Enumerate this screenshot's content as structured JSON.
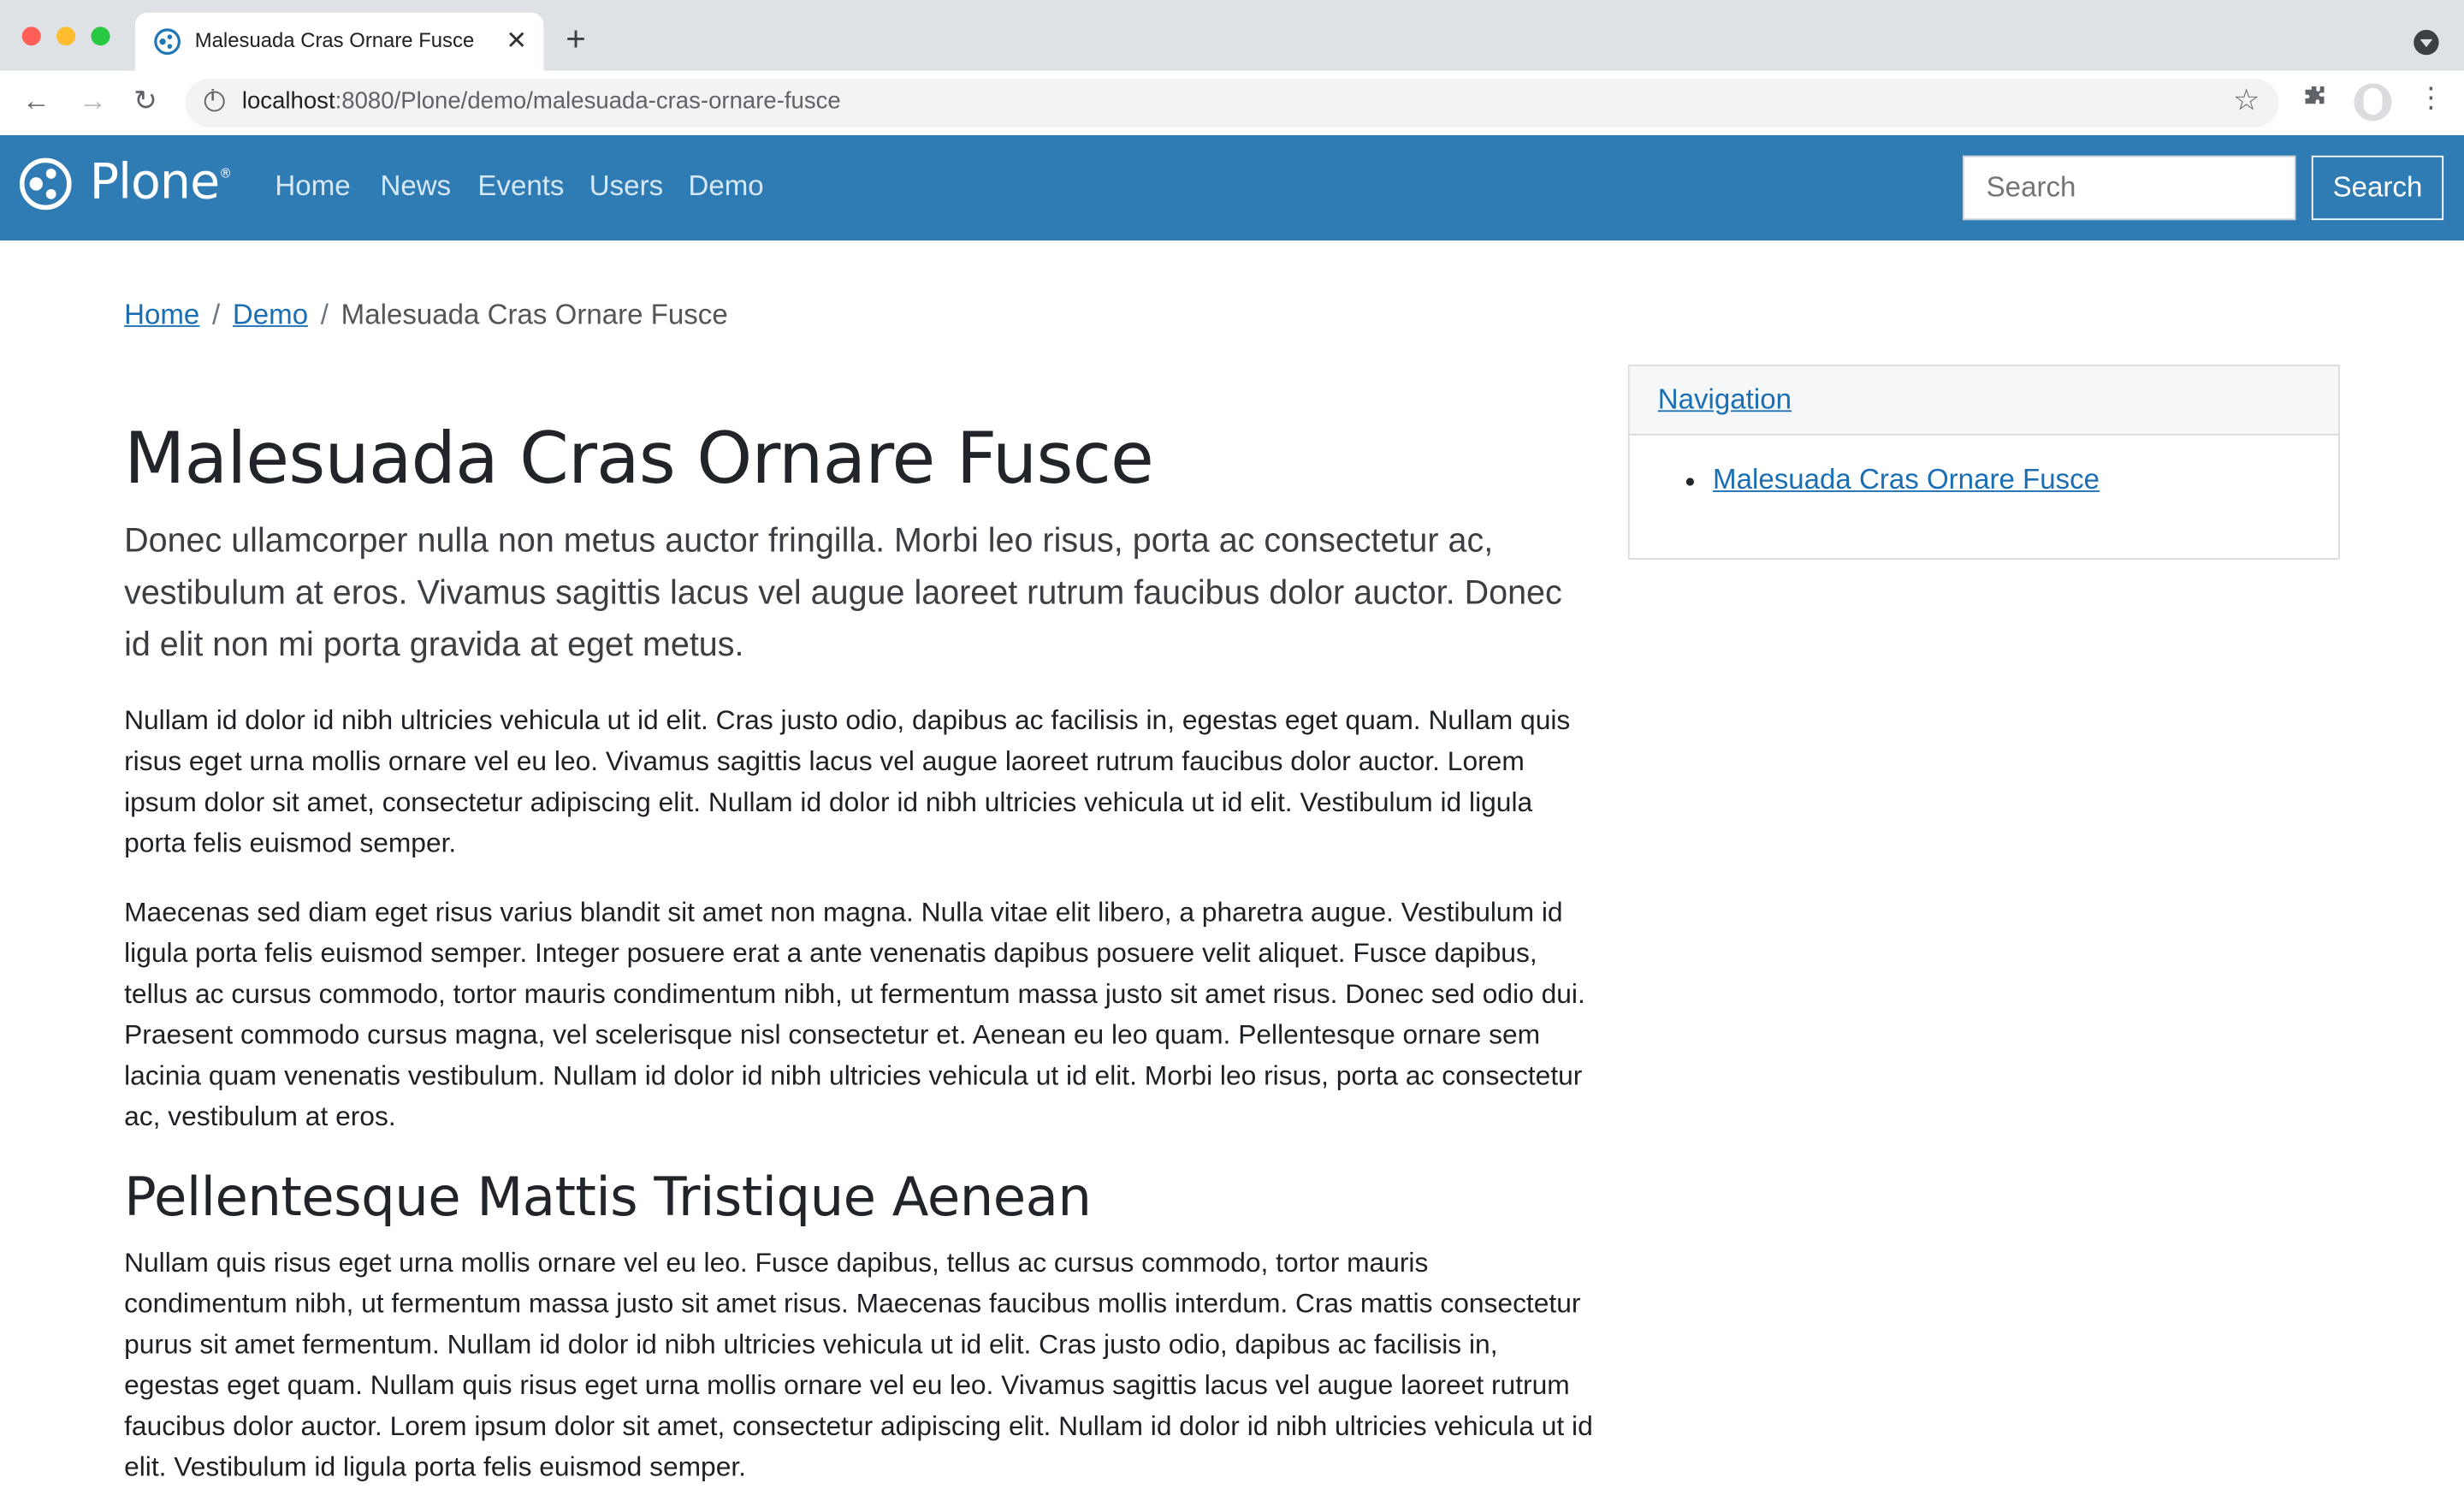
{
  "browser": {
    "tab_title": "Malesuada Cras Ornare Fusce",
    "url_host": "localhost",
    "url_rest": ":8080/Plone/demo/malesuada-cras-ornare-fusce"
  },
  "header": {
    "logo_text": "Plone",
    "nav": [
      "Home",
      "News",
      "Events",
      "Users",
      "Demo"
    ],
    "search_placeholder": "Search",
    "search_button": "Search",
    "brand_color": "#2f7cb4"
  },
  "breadcrumb": {
    "home": "Home",
    "demo": "Demo",
    "current": "Malesuada Cras Ornare Fusce"
  },
  "content": {
    "title": "Malesuada Cras Ornare Fusce",
    "lead": "Donec ullamcorper nulla non metus auctor fringilla. Morbi leo risus, porta ac consectetur ac, vestibulum at eros. Vivamus sagittis lacus vel augue laoreet rutrum faucibus dolor auctor. Donec id elit non mi porta gravida at eget metus.",
    "paragraph1": "Nullam id dolor id nibh ultricies vehicula ut id elit. Cras justo odio, dapibus ac facilisis in, egestas eget quam. Nullam quis risus eget urna mollis ornare vel eu leo. Vivamus sagittis lacus vel augue laoreet rutrum faucibus dolor auctor. Lorem ipsum dolor sit amet, consectetur adipiscing elit. Nullam id dolor id nibh ultricies vehicula ut id elit. Vestibulum id ligula porta felis euismod semper.",
    "paragraph2": "Maecenas sed diam eget risus varius blandit sit amet non magna. Nulla vitae elit libero, a pharetra augue. Vestibulum id ligula porta felis euismod semper. Integer posuere erat a ante venenatis dapibus posuere velit aliquet. Fusce dapibus, tellus ac cursus commodo, tortor mauris condimentum nibh, ut fermentum massa justo sit amet risus. Donec sed odio dui. Praesent commodo cursus magna, vel scelerisque nisl consectetur et. Aenean eu leo quam. Pellentesque ornare sem lacinia quam venenatis vestibulum. Nullam id dolor id nibh ultricies vehicula ut id elit. Morbi leo risus, porta ac consectetur ac, vestibulum at eros.",
    "subheading": "Pellentesque Mattis Tristique Aenean",
    "paragraph3": "Nullam quis risus eget urna mollis ornare vel eu leo. Fusce dapibus, tellus ac cursus commodo, tortor mauris condimentum nibh, ut fermentum massa justo sit amet risus. Maecenas faucibus mollis interdum. Cras mattis consectetur purus sit amet fermentum. Nullam id dolor id nibh ultricies vehicula ut id elit. Cras justo odio, dapibus ac facilisis in, egestas eget quam. Nullam quis risus eget urna mollis ornare vel eu leo. Vivamus sagittis lacus vel augue laoreet rutrum faucibus dolor auctor. Lorem ipsum dolor sit amet, consectetur adipiscing elit. Nullam id dolor id nibh ultricies vehicula ut id elit. Vestibulum id ligula porta felis euismod semper."
  },
  "portlet": {
    "header": "Navigation",
    "items": [
      "Malesuada Cras Ornare Fusce"
    ]
  }
}
